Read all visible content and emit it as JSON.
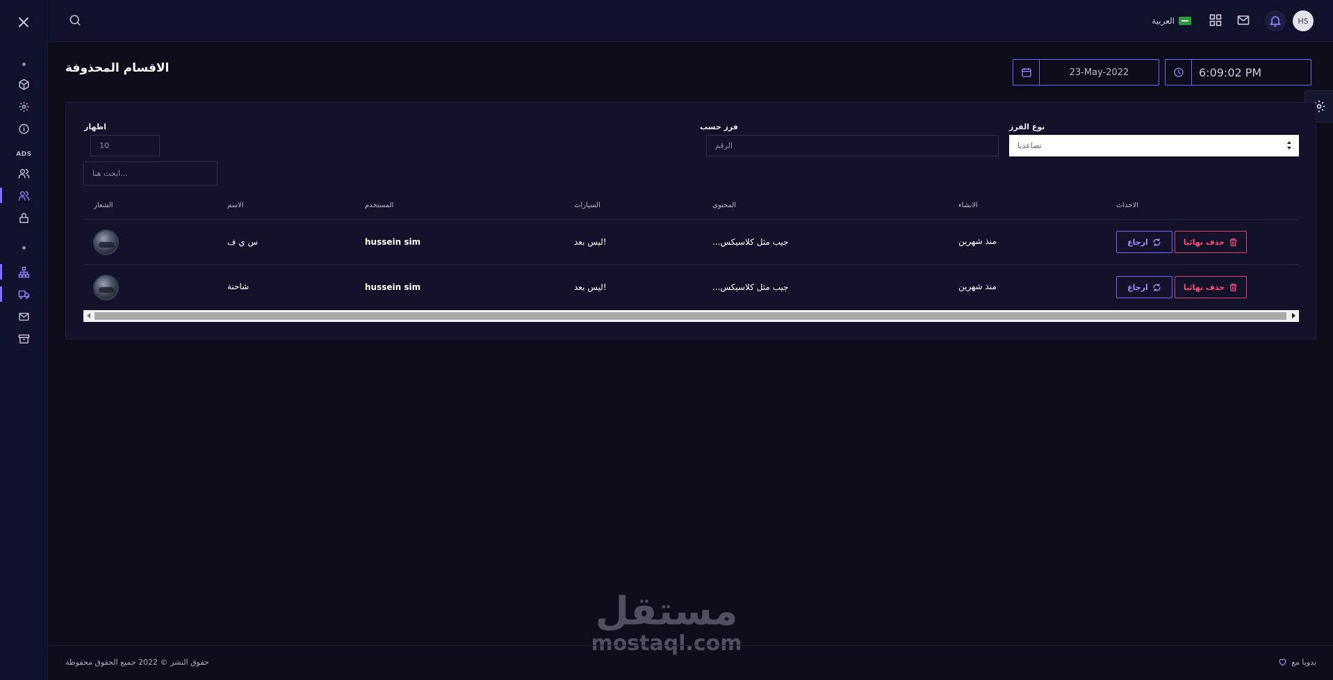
{
  "topbar": {
    "language": "العربية",
    "avatar_initials": "HS"
  },
  "sidebar": {
    "section_label": "ADS"
  },
  "page": {
    "title": "الاقسام المحذوفة",
    "date": "23-May-2022",
    "time": "6:09:02 PM"
  },
  "filters": {
    "show_label": "اظهار",
    "show_value": "10",
    "search_placeholder": "ابحث هنا...",
    "sort_by_label": "فرز حسب",
    "sort_by_placeholder": "الرقم",
    "sort_type_label": "نوع الفرز",
    "sort_type_value": "تصاعديا"
  },
  "table": {
    "columns": {
      "logo": "الشعار",
      "name": "الاسم",
      "user": "المستخدم",
      "cars": "السيارات",
      "content": "المحتوى",
      "created": "الانشاء",
      "actions": "الاحداث"
    },
    "rows": [
      {
        "name": "س ي ف",
        "user": "hussein sim",
        "cars": "ليس بعد!",
        "content": "...جيب مثل كلاسيكس",
        "created": "منذ شهرين"
      },
      {
        "name": "شاحنة",
        "user": "hussein sim",
        "cars": "ليس بعد!",
        "content": "...جيب مثل كلاسيكس",
        "created": "منذ شهرين"
      }
    ],
    "delete_label": "حذف نهائيا",
    "restore_label": "ارجاع"
  },
  "footer": {
    "copyright": "حقوق النشر © 2022 جميع الحقوق محفوظة",
    "made_with": "بدويا مع"
  },
  "watermark": {
    "arabic": "مستقل",
    "latin": "mostaql.com"
  },
  "colors": {
    "accent": "#6f66ff",
    "danger": "#ff4d7a",
    "background": "#0d0e1b",
    "panel": "#12132a"
  }
}
